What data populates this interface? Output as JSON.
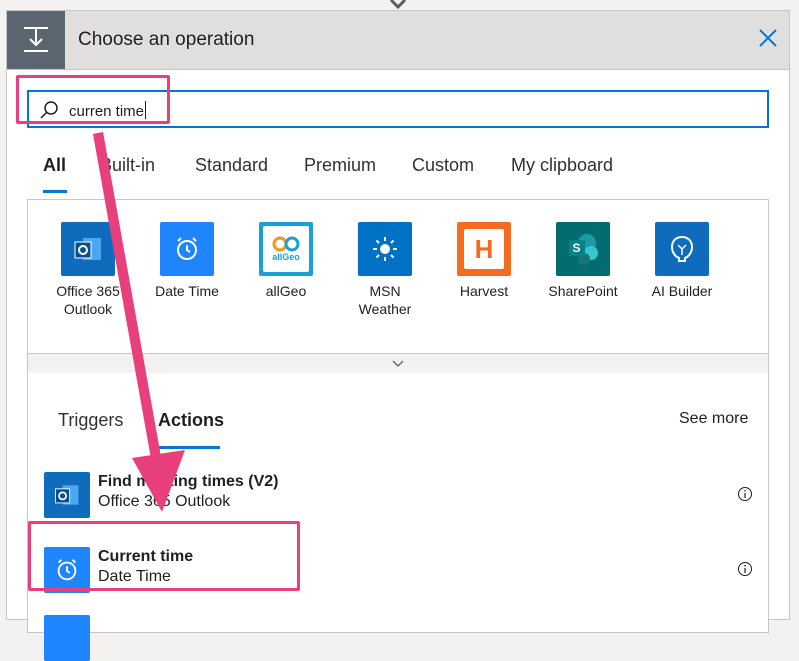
{
  "dialog": {
    "title": "Choose an operation",
    "header_icon": "operation-icon",
    "close_icon": "close-icon"
  },
  "search": {
    "value": "curren time",
    "icon": "search-icon"
  },
  "tabs": [
    {
      "label": "All",
      "active": true
    },
    {
      "label": "Built-in",
      "active": false
    },
    {
      "label": "Standard",
      "active": false
    },
    {
      "label": "Premium",
      "active": false
    },
    {
      "label": "Custom",
      "active": false
    },
    {
      "label": "My clipboard",
      "active": false
    }
  ],
  "connectors": [
    {
      "label": "Office 365 Outlook",
      "icon": "outlook-icon",
      "color": "#0f6cbd"
    },
    {
      "label": "Date Time",
      "icon": "alarm-clock-icon",
      "color": "#1f85ff"
    },
    {
      "label": "allGeo",
      "icon": "allgeo-icon",
      "color": "#1aa0d8"
    },
    {
      "label": "MSN Weather",
      "icon": "sun-icon",
      "color": "#0072c6"
    },
    {
      "label": "Harvest",
      "icon": "harvest-h-icon",
      "color": "#f36c21"
    },
    {
      "label": "SharePoint",
      "icon": "sharepoint-icon",
      "color": "#036c70"
    },
    {
      "label": "AI Builder",
      "icon": "ai-builder-icon",
      "color": "#0f6cbd"
    }
  ],
  "allgeo_logo_text": "allGeo",
  "harvest_logo_text": "H",
  "sharepoint_logo_text": "S",
  "subtabs": [
    {
      "label": "Triggers",
      "active": false
    },
    {
      "label": "Actions",
      "active": true
    }
  ],
  "see_more": "See more",
  "actions": [
    {
      "title": "Find meeting times (V2)",
      "connector": "Office 365 Outlook",
      "icon": "outlook-icon",
      "color": "#0f6cbd"
    },
    {
      "title": "Current time",
      "connector": "Date Time",
      "icon": "alarm-clock-icon",
      "color": "#1f85ff"
    }
  ],
  "annotation_color": "#e8407c"
}
